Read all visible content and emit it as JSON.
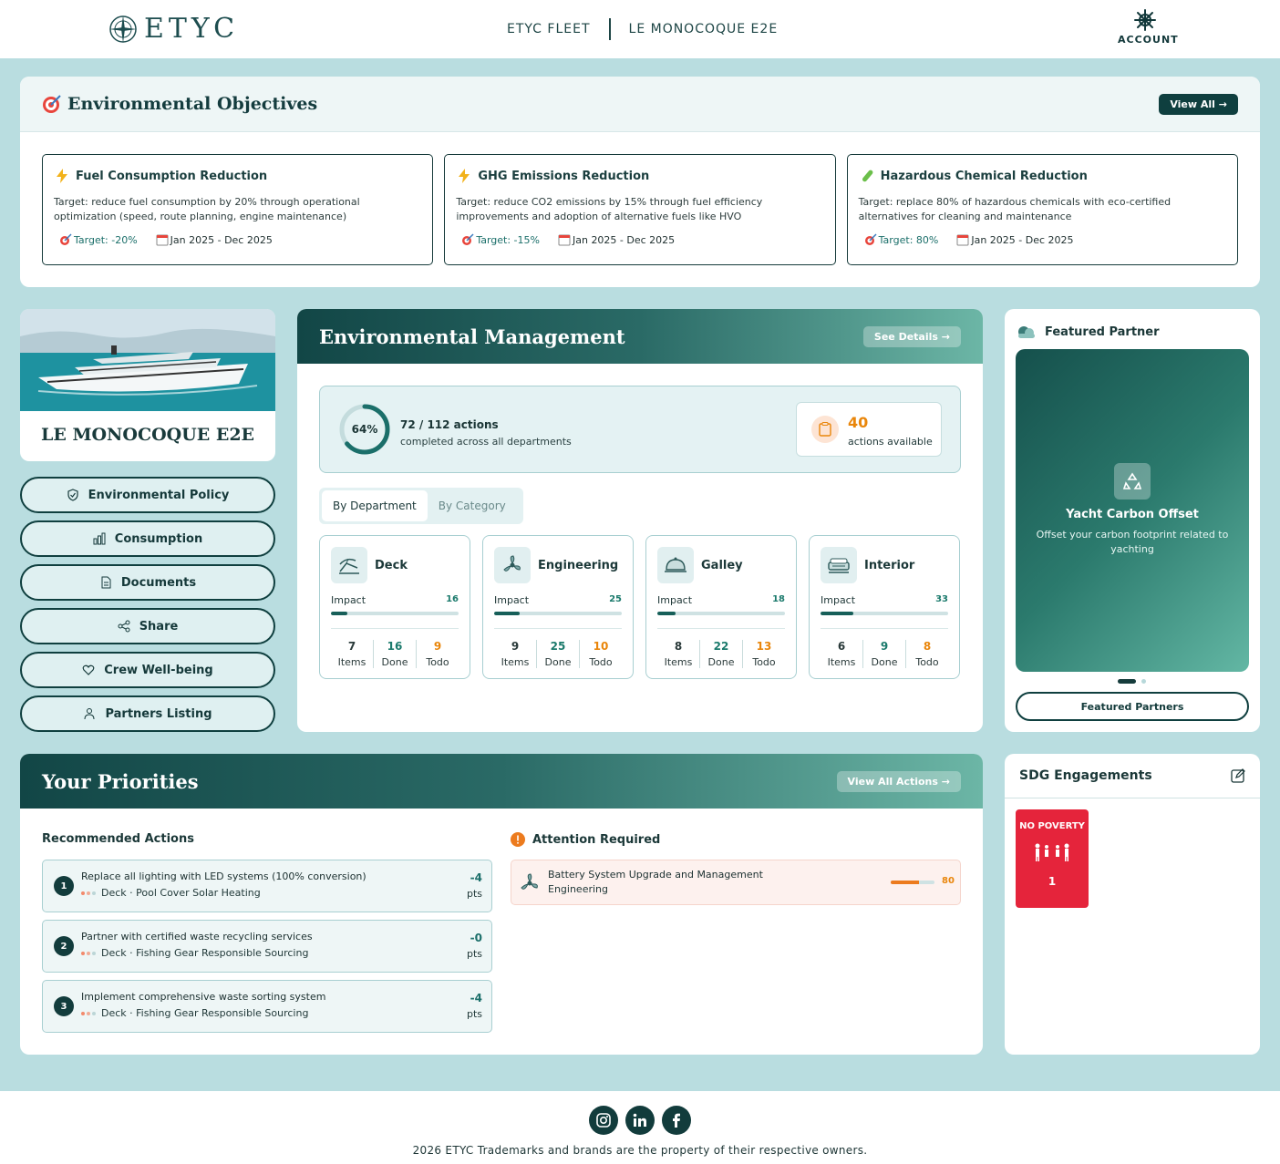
{
  "header": {
    "logo_text": "ETYC",
    "nav": [
      "ETYC FLEET",
      "LE MONOCOQUE E2E"
    ],
    "account_label": "ACCOUNT"
  },
  "objectives": {
    "title": "Environmental Objectives",
    "view_all": "View All →",
    "items": [
      {
        "title": "Fuel Consumption Reduction",
        "icon": "lightning-icon",
        "text": "Target: reduce fuel consumption by 20% through operational optimization (speed, route planning, engine maintenance)",
        "target": "Target: -20%",
        "period": "Jan 2025 - Dec 2025"
      },
      {
        "title": "GHG Emissions Reduction",
        "icon": "lightning-icon",
        "text": "Target: reduce CO2 emissions by 15% through fuel efficiency improvements and adoption of alternative fuels like HVO",
        "target": "Target: -15%",
        "period": "Jan 2025 - Dec 2025"
      },
      {
        "title": "Hazardous Chemical Reduction",
        "icon": "test-tube-icon",
        "text": "Target: replace 80% of hazardous chemicals with eco-certified alternatives for cleaning and maintenance",
        "target": "Target: 80%",
        "period": "Jan 2025 - Dec 2025"
      }
    ]
  },
  "vessel": {
    "name": "LE MONOCOQUE E2E",
    "menu": [
      {
        "label": "Environmental Policy",
        "icon": "shield-icon"
      },
      {
        "label": "Consumption",
        "icon": "bar-chart-icon"
      },
      {
        "label": "Documents",
        "icon": "document-icon"
      },
      {
        "label": "Share",
        "icon": "share-icon"
      },
      {
        "label": "Crew Well-being",
        "icon": "heart-icon"
      },
      {
        "label": "Partners Listing",
        "icon": "people-icon"
      }
    ]
  },
  "management": {
    "title": "Environmental Management",
    "see_details": "See Details →",
    "progress_percent": 64,
    "progress_label": "64%",
    "actions_done": "72 / 112 actions",
    "actions_sub": "completed across all departments",
    "available_count": "40",
    "available_label": "actions available",
    "tabs": [
      "By Department",
      "By Category"
    ],
    "impact_label": "Impact",
    "stat_labels": [
      "Items",
      "Done",
      "Todo"
    ],
    "departments": [
      {
        "name": "Deck",
        "icon": "deck-chair-icon",
        "impact": 16,
        "impact_fraction": 0.13,
        "items": "7",
        "done": "16",
        "todo": "9"
      },
      {
        "name": "Engineering",
        "icon": "propeller-icon",
        "impact": 25,
        "impact_fraction": 0.2,
        "items": "9",
        "done": "25",
        "todo": "10"
      },
      {
        "name": "Galley",
        "icon": "cloche-icon",
        "impact": 18,
        "impact_fraction": 0.14,
        "items": "8",
        "done": "22",
        "todo": "13"
      },
      {
        "name": "Interior",
        "icon": "bed-icon",
        "impact": 33,
        "impact_fraction": 0.26,
        "items": "6",
        "done": "9",
        "todo": "8"
      }
    ]
  },
  "partner": {
    "title": "Featured Partner",
    "slide_title": "Yacht Carbon Offset",
    "slide_desc": "Offset your carbon footprint related to yachting",
    "button": "Featured Partners"
  },
  "priorities": {
    "title": "Your Priorities",
    "view_all": "View All Actions →",
    "recommended_label": "Recommended Actions",
    "attention_label": "Attention Required",
    "recommended": [
      {
        "num": "1",
        "title": "Replace all lighting with LED systems (100% conversion)",
        "sub": "Deck · Pool Cover Solar Heating",
        "pts": "-4",
        "unit": "pts"
      },
      {
        "num": "2",
        "title": "Partner with certified waste recycling services",
        "sub": "Deck · Fishing Gear Responsible Sourcing",
        "pts": "-0",
        "unit": "pts"
      },
      {
        "num": "3",
        "title": "Implement comprehensive waste sorting system",
        "sub": "Deck · Fishing Gear Responsible Sourcing",
        "pts": "-4",
        "unit": "pts"
      }
    ],
    "attention": {
      "title": "Battery System Upgrade and Management",
      "sub": "Engineering",
      "value": "80",
      "fraction": 0.65
    }
  },
  "sdg": {
    "title": "SDG Engagements",
    "tile_title": "NO POVERTY",
    "tile_number": "1",
    "tile_color": "#e5243b"
  },
  "footer": {
    "socials": [
      "instagram-icon",
      "linkedin-icon",
      "facebook-icon"
    ],
    "copyright": "2026 ETYC Trademarks and brands are the property of their respective owners."
  }
}
